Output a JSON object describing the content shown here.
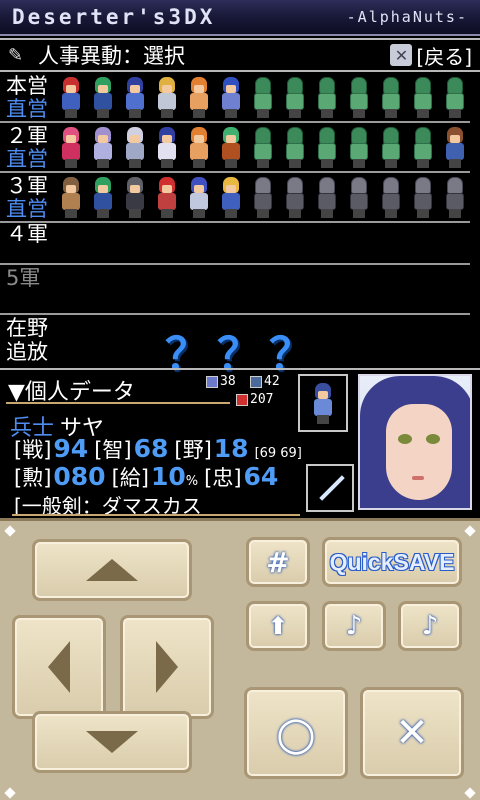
{
  "app": {
    "title": "Deserter's3DX",
    "brand": "-AlphaNuts-"
  },
  "header": {
    "title": "人事異動：選択",
    "back_label": "[戻る]",
    "back_icon": "close-x-icon",
    "title_icon": "feather-icon"
  },
  "units": [
    {
      "labels": [
        "本営",
        "直営"
      ],
      "colors": [
        "#ffffff",
        "#4f8cf0"
      ],
      "sprites": [
        "red-hair-hero",
        "green-hair-hero",
        "blue-armor-hero",
        "blonde-knight",
        "orange-hair-girl",
        "blue-mage",
        "soldier",
        "soldier",
        "soldier",
        "soldier",
        "soldier",
        "soldier",
        "soldier"
      ]
    },
    {
      "labels": [
        "２軍",
        "直営"
      ],
      "colors": [
        "#ffffff",
        "#4f8cf0"
      ],
      "sprites": [
        "pink-hair-girl",
        "purple-knight",
        "white-knight",
        "blue-hood-mage",
        "orange-hair-girl",
        "green-hair-girl",
        "soldier",
        "soldier",
        "soldier",
        "soldier",
        "soldier",
        "soldier",
        "blue-fighter"
      ]
    },
    {
      "labels": [
        "３軍",
        "直営"
      ],
      "colors": [
        "#ffffff",
        "#4f8cf0"
      ],
      "sprites": [
        "brown-fighter",
        "green-hair-hero",
        "dark-knight",
        "red-hair-girl",
        "blue-hair-knight",
        "blonde-girl",
        "grunt",
        "grunt",
        "grunt",
        "grunt",
        "grunt",
        "grunt",
        "grunt"
      ]
    },
    {
      "labels": [
        "４軍"
      ],
      "colors": [
        "#ffffff"
      ],
      "sprites": []
    },
    {
      "labels": [
        "5軍"
      ],
      "colors": [
        "#8a8a8a"
      ],
      "sprites": []
    }
  ],
  "reserve": {
    "labels": [
      "在野",
      "追放"
    ],
    "unknown": "？？？"
  },
  "personal": {
    "title": "▼個人データ",
    "mini_stats": {
      "a": "38",
      "b": "42",
      "c": "207",
      "d": "69",
      "e": "69"
    },
    "rank": "兵士",
    "name": "サヤ",
    "stats_row1": [
      {
        "k": "[戦]",
        "v": "94"
      },
      {
        "k": "[智]",
        "v": "68"
      },
      {
        "k": "[野]",
        "v": "18"
      }
    ],
    "stats_row2": [
      {
        "k": "[勲]",
        "v": "080"
      },
      {
        "k": "[給]",
        "v": "10",
        "suffix": "%"
      },
      {
        "k": "[忠]",
        "v": "64"
      }
    ],
    "weapon": "[一般剣：ダマスカス"
  },
  "controls": {
    "quicksave": "QuickSAVE",
    "hash": "#",
    "confirm": "○",
    "cancel": "✕",
    "music_a": "♪",
    "music_b": "♪",
    "up_small": "⬆"
  },
  "colors": {
    "accent_blue": "#4f8cf0",
    "pad_bg": "#c4b89c",
    "button_face": "#efe4c8"
  }
}
